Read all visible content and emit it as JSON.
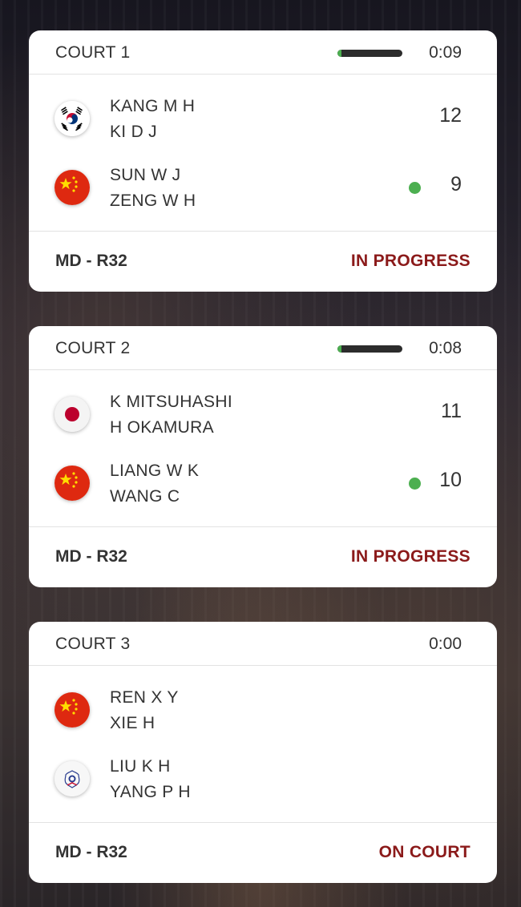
{
  "matches": [
    {
      "court": "COURT 1",
      "timer": "0:09",
      "progress": 0.06,
      "round": "MD - R32",
      "status": "IN PROGRESS",
      "teams": [
        {
          "flag": "korea-flag",
          "players": [
            "KANG M H",
            "KI D J"
          ],
          "score": "12",
          "serving": false
        },
        {
          "flag": "china-flag",
          "players": [
            "SUN W J",
            "ZENG W H"
          ],
          "score": "9",
          "serving": true
        }
      ]
    },
    {
      "court": "COURT 2",
      "timer": "0:08",
      "progress": 0.06,
      "round": "MD - R32",
      "status": "IN PROGRESS",
      "teams": [
        {
          "flag": "japan-flag",
          "players": [
            "K MITSUHASHI",
            "H OKAMURA"
          ],
          "score": "11",
          "serving": false
        },
        {
          "flag": "china-flag",
          "players": [
            "LIANG W K",
            "WANG C"
          ],
          "score": "10",
          "serving": true
        }
      ]
    },
    {
      "court": "COURT 3",
      "timer": "0:00",
      "progress": null,
      "round": "MD - R32",
      "status": "ON COURT",
      "teams": [
        {
          "flag": "china-flag",
          "players": [
            "REN X Y",
            "XIE H"
          ],
          "score": "",
          "serving": false
        },
        {
          "flag": "chinese-taipei-flag",
          "players": [
            "LIU K H",
            "YANG P H"
          ],
          "score": "",
          "serving": false
        }
      ]
    }
  ],
  "colors": {
    "status_red": "#8b1a1a",
    "serve_green": "#4caf50",
    "progress_track": "#2c2c2c"
  }
}
